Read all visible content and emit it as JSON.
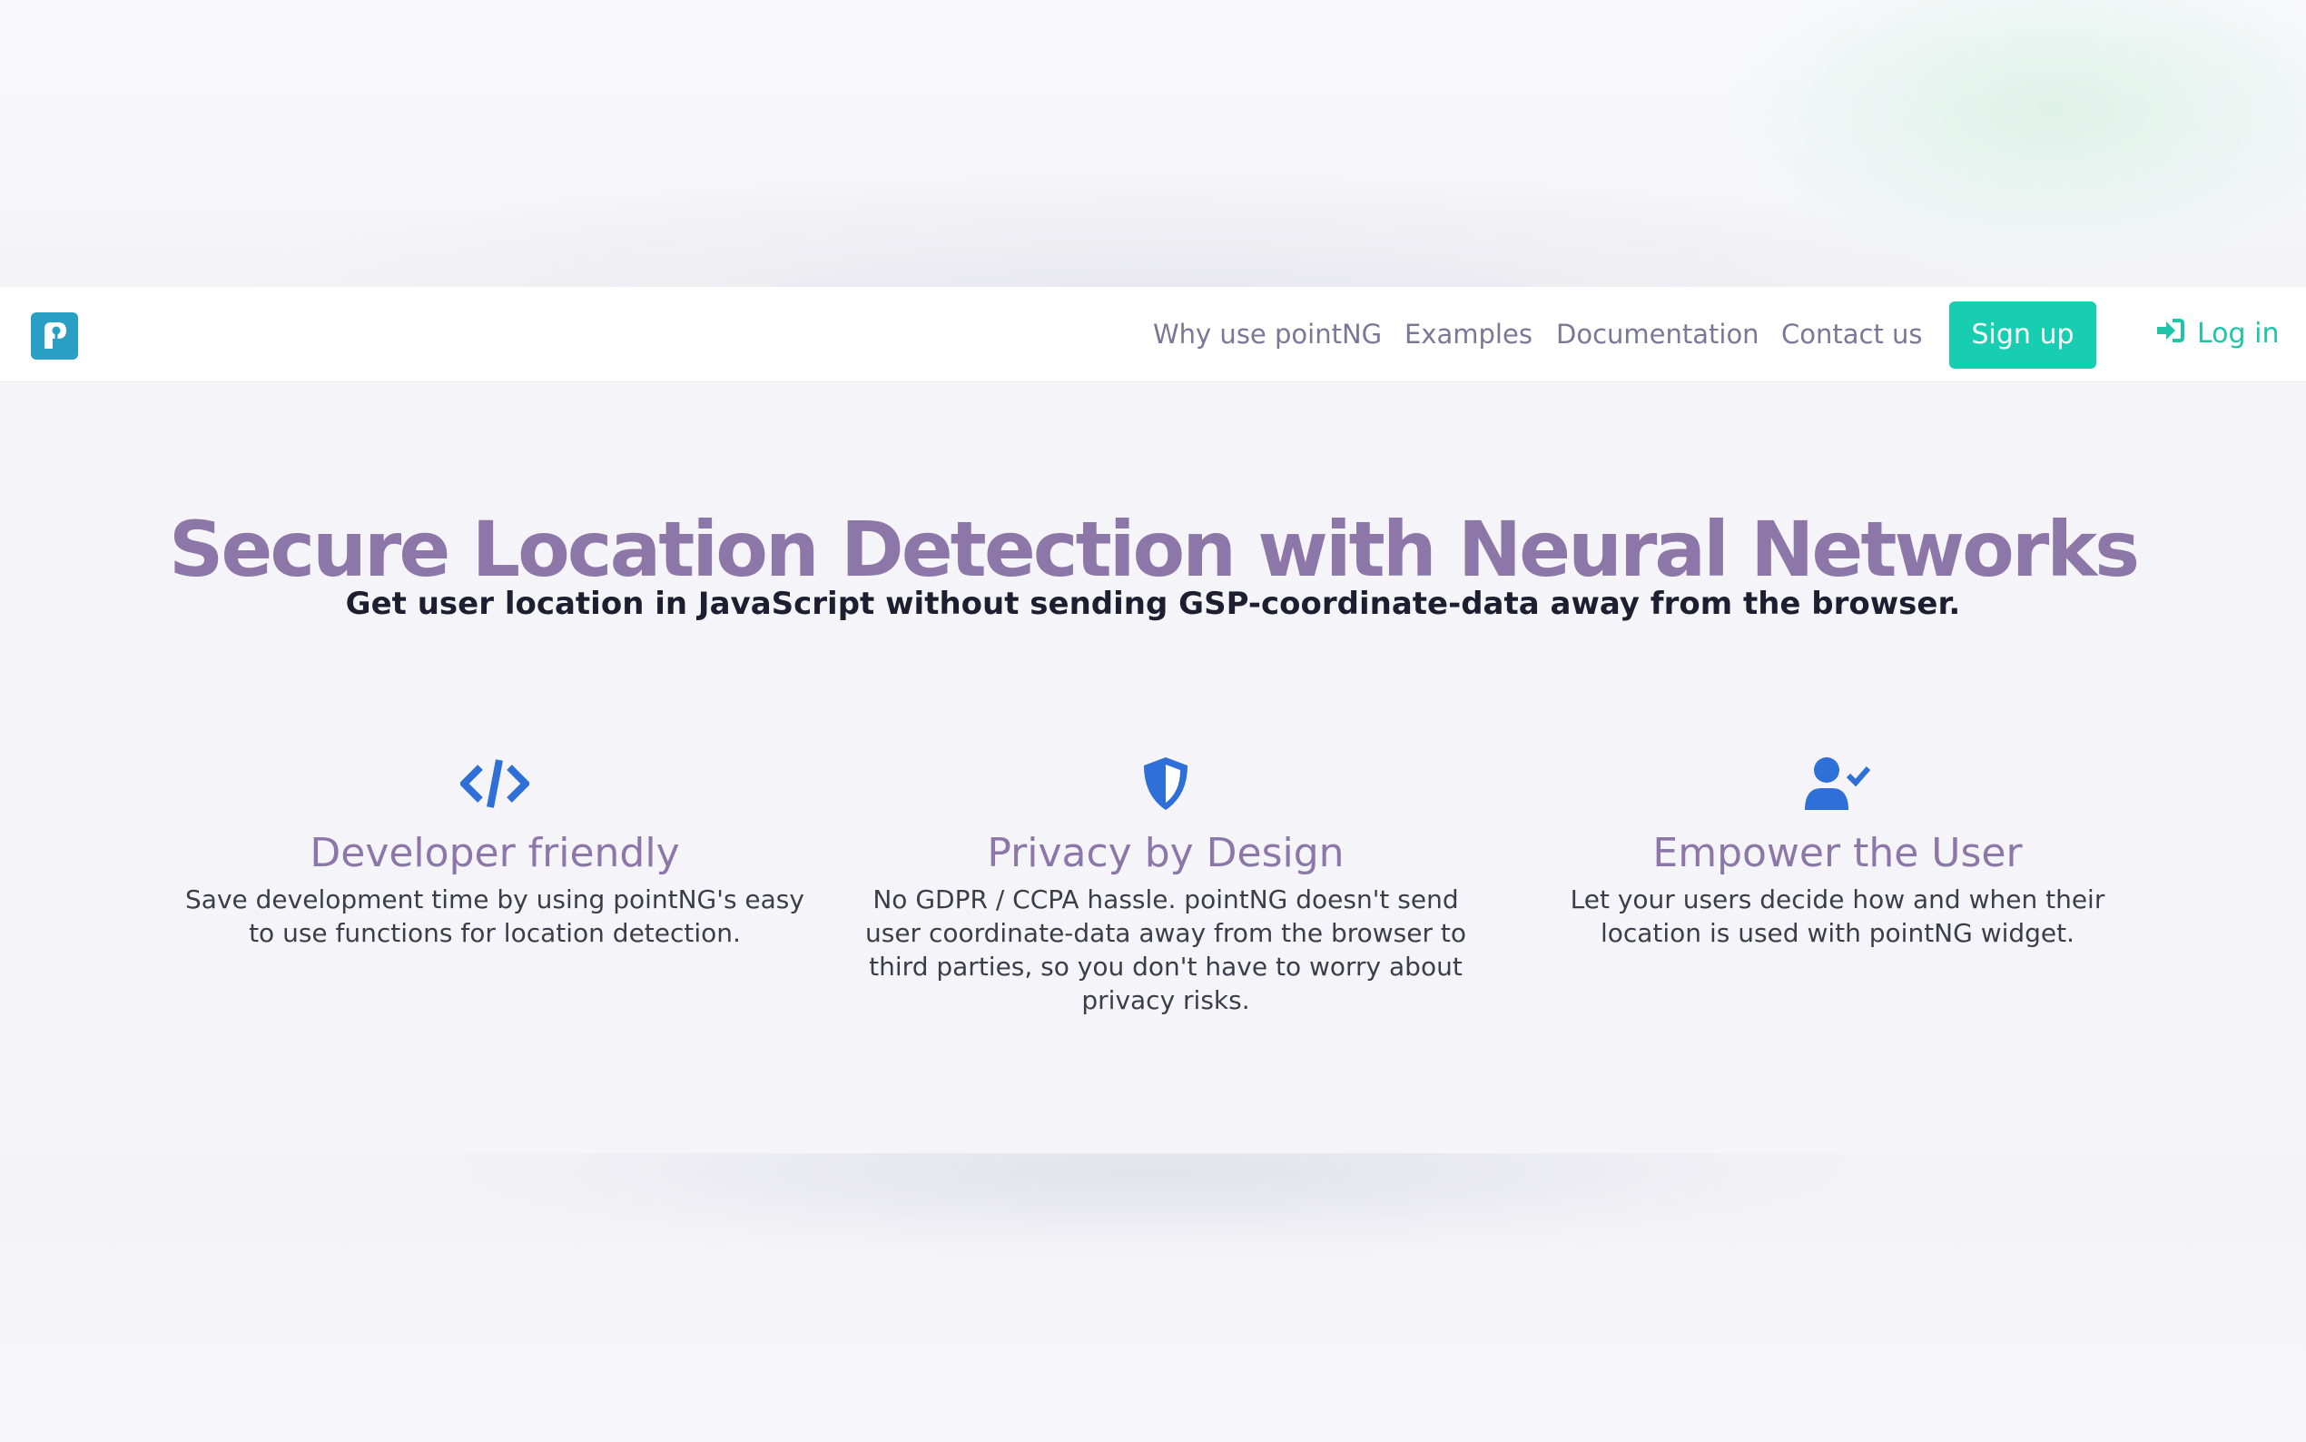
{
  "colors": {
    "brand_purple": "#8c77a8",
    "accent_teal": "#17cfb0",
    "icon_blue": "#2f6fd8",
    "nav_text": "#7a7896",
    "logo_blue": "#2a9fc6"
  },
  "navbar": {
    "logo_icon": "pointng-logo-icon",
    "links": [
      {
        "label": "Why use pointNG"
      },
      {
        "label": "Examples"
      },
      {
        "label": "Documentation"
      },
      {
        "label": "Contact us"
      }
    ],
    "signup_label": "Sign up",
    "login_label": "Log in",
    "login_icon": "sign-in-icon"
  },
  "hero": {
    "title": "Secure Location Detection with Neural Networks",
    "subtitle": "Get user location in JavaScript without sending GSP-coordinate-data away from the browser."
  },
  "features": [
    {
      "icon": "code-icon",
      "title": "Developer friendly",
      "text": "Save development time by using pointNG's easy to use functions for location detection."
    },
    {
      "icon": "shield-icon",
      "title": "Privacy by Design",
      "text": "No GDPR / CCPA hassle. pointNG doesn't send user coordinate-data away from the browser to third parties, so you don't have to worry about privacy risks."
    },
    {
      "icon": "user-check-icon",
      "title": "Empower the User",
      "text": "Let your users decide how and when their location is used with pointNG widget."
    }
  ]
}
